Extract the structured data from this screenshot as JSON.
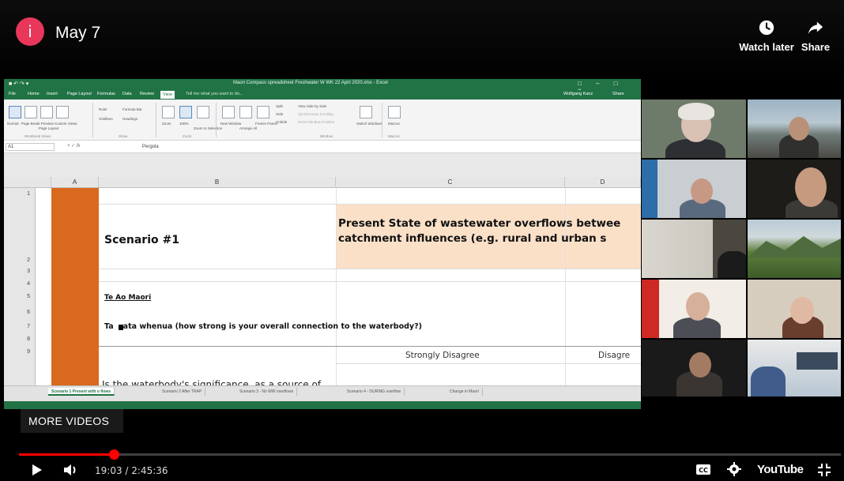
{
  "player": {
    "channel_initial": "i",
    "title": "May 7",
    "watch_later_label": "Watch later",
    "share_label": "Share",
    "more_videos_label": "MORE VIDEOS",
    "time_display": "19:03 / 2:45:36",
    "progress": 0.115,
    "brand_label": "YouTube",
    "accent_color": "#ff0000",
    "icons": [
      "play-icon",
      "volume-icon",
      "clock-icon",
      "share-arrow-icon",
      "captions-icon",
      "gear-icon",
      "fullscreen-icon"
    ]
  },
  "excel": {
    "window_title": "Maori Compass spreadsheet Freshwater W WK 22 April 2020.xlsx - Excel",
    "tell_me": "Tell me what you want to do...",
    "user": "Wolfgang Kanz",
    "share": "Share",
    "menu": [
      "File",
      "Home",
      "Insert",
      "Page Layout",
      "Formulas",
      "Data",
      "Review",
      "View"
    ],
    "name_box": "A1",
    "formula": "Pergola",
    "ribbon": {
      "normal": "Normal",
      "page_break": "Page Break Preview",
      "page_layout": "Page Layout",
      "custom_views": "Custom Views",
      "ruler": "Ruler",
      "formula_bar": "Formula Bar",
      "gridlines": "Gridlines",
      "headings": "Headings",
      "zoom": "Zoom",
      "zoom100": "100%",
      "zoom_sel": "Zoom to Selection",
      "new_window": "New Window",
      "arrange": "Arrange All",
      "freeze": "Freeze Panes",
      "split": "Split",
      "hide": "Hide",
      "unhide": "Unhide",
      "side_by_side": "View Side by Side",
      "sync_scroll": "Synchronous Scrolling",
      "reset_pos": "Reset Window Position",
      "switch": "Switch Windows",
      "macros": "Macros",
      "g_workbook": "Workbook Views",
      "g_show": "Show",
      "g_zoom": "Zoom",
      "g_window": "Window",
      "g_macros": "Macros"
    },
    "columns": [
      "A",
      "B",
      "C",
      "D"
    ],
    "rows": [
      "1",
      "2",
      "3",
      "4",
      "5",
      "6",
      "7",
      "8",
      "9"
    ],
    "cells": {
      "scenario": "Scenario #1",
      "present_line1": "Present State of wastewater overflows betwee",
      "present_line2": "catchment influences (e.g. rural and urban s",
      "te_ao": "Te Ao Maori",
      "tuurangi_a": "Ta",
      "tuurangi_b": "ata whenua (how strong is your overall connection to the waterbody?)",
      "strongly_disagree": "Strongly Disagree",
      "disagree": "Disagre",
      "waterbody": "Is the waterbody's significance, as a source of"
    },
    "sheet_tabs": [
      "Scenario 1 Present with o flows",
      "Scenario 2 After TRAP",
      "Scenario 3 - No WW overflows",
      "Scenario 4 - DURING overflow",
      "Change in Maori"
    ],
    "accent_color": "#217346",
    "highlight_color": "#fbe0c8",
    "column_a_color": "#d9691f"
  }
}
